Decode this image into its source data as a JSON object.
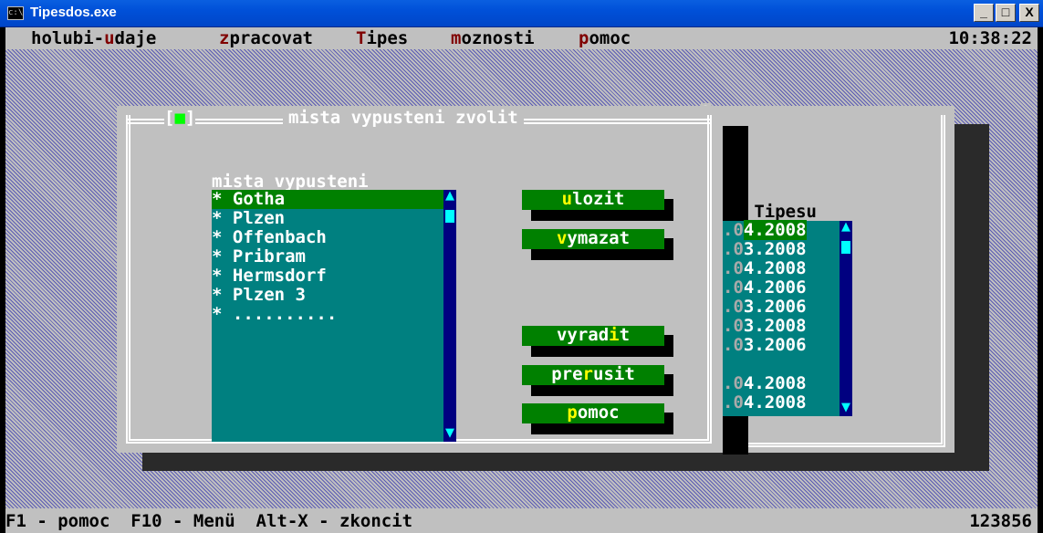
{
  "window": {
    "title": "Tipesdos.exe",
    "icon_label": "c:\\",
    "minimize": "_",
    "maximize": "□",
    "close": "X"
  },
  "menubar": {
    "items": [
      {
        "pre": "holubi-",
        "hk": "u",
        "post": "daje"
      },
      {
        "pre": "",
        "hk": "z",
        "post": "pracovat"
      },
      {
        "pre": "",
        "hk": "T",
        "post": "ipes"
      },
      {
        "pre": "",
        "hk": "m",
        "post": "oznosti"
      },
      {
        "pre": "",
        "hk": "p",
        "post": "omoc"
      }
    ],
    "clock": "10:38:22"
  },
  "statusbar": {
    "left": "F1 - pomoc  F10 - Menü  Alt-X - zkoncit",
    "right": "123856"
  },
  "background_window": {
    "title_fragment": "t",
    "column_header": "od Tipesu",
    "rows": [
      {
        "dim": ".0",
        "text": "4.2008",
        "highlight": true
      },
      {
        "dim": ".0",
        "text": "3.2008",
        "highlight": false
      },
      {
        "dim": ".0",
        "text": "4.2008",
        "highlight": false
      },
      {
        "dim": ".0",
        "text": "4.2006",
        "highlight": false
      },
      {
        "dim": ".0",
        "text": "3.2006",
        "highlight": false
      },
      {
        "dim": ".0",
        "text": "3.2008",
        "highlight": false
      },
      {
        "dim": ".0",
        "text": "3.2006",
        "highlight": false
      },
      {
        "dim": "",
        "text": "",
        "highlight": false
      },
      {
        "dim": ".0",
        "text": "4.2008",
        "highlight": false
      },
      {
        "dim": ".0",
        "text": "4.2008",
        "highlight": false
      }
    ]
  },
  "dialog": {
    "close_left": "[",
    "close_mark": "■",
    "close_right": "]",
    "title": "mista vypusteni zvolit",
    "list_label": "mista vypusteni",
    "list_items": [
      "* Gotha",
      "* Plzen",
      "* Offenbach",
      "* Pribram",
      "* Hermsdorf",
      "* Plzen 3",
      "* .........."
    ],
    "selected_index": 0,
    "scroll_up": "▲",
    "scroll_down": "▼",
    "buttons": {
      "ulozit": {
        "pre": "",
        "hk": "u",
        "post": "lozit"
      },
      "vymazat": {
        "pre": "",
        "hk": "v",
        "post": "ymazat"
      },
      "vyradit": {
        "pre": "vyrad",
        "hk": "i",
        "post": "t"
      },
      "prerusit": {
        "pre": "pre",
        "hk": "r",
        "post": "usit"
      },
      "pomoc": {
        "pre": "",
        "hk": "p",
        "post": "omoc"
      }
    }
  },
  "colors": {
    "titlebar": "#0050d8",
    "console_bg": "#c0c0c0",
    "list_bg": "#008080",
    "selection": "#008000",
    "scrollbar": "#000080",
    "hotkey_menu": "#800000",
    "hotkey_button": "#ffff00"
  }
}
